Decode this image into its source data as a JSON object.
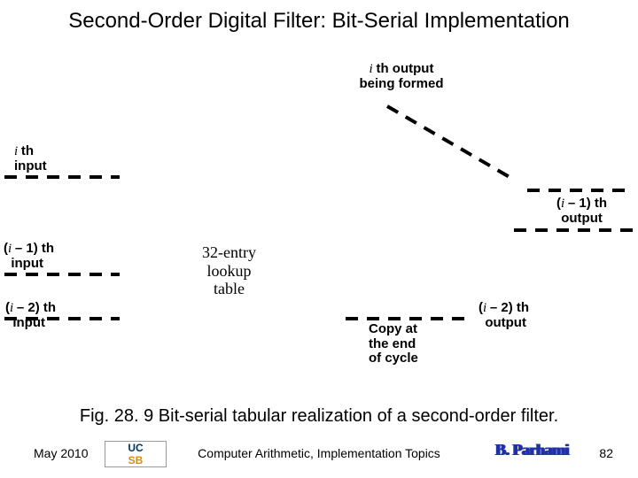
{
  "title": "Second-Order Digital Filter: Bit-Serial Implementation",
  "labels": {
    "ith_output_top": "th output",
    "being_formed": "being formed",
    "ith": "th",
    "input": "input",
    "i_minus_1_th": "– 1) th",
    "i_minus_2_th": "– 2) th",
    "output": "output",
    "lookup_l1": "32-entry",
    "lookup_l2": "lookup",
    "lookup_l3": "table",
    "copy_l1": "Copy at",
    "copy_l2": "the end",
    "copy_l3": "of cycle"
  },
  "caption": "Fig. 28. 9   Bit-serial tabular realization of a second-order filter.",
  "footer": {
    "date": "May 2010",
    "logo_top": "UC",
    "logo_bottom": "SB",
    "center": "Computer Arithmetic, Implementation Topics",
    "author": "B. Parhami",
    "pagenum": "82"
  },
  "chart_data": {
    "type": "diagram",
    "title": "Bit-serial tabular realization of a second-order filter",
    "inputs": [
      "i th input",
      "(i-1) th input",
      "(i-2) th input"
    ],
    "outputs": [
      "i th output being formed",
      "(i-1) th output",
      "(i-2) th output"
    ],
    "block": "32-entry lookup table",
    "note": "Copy at the end of cycle"
  }
}
